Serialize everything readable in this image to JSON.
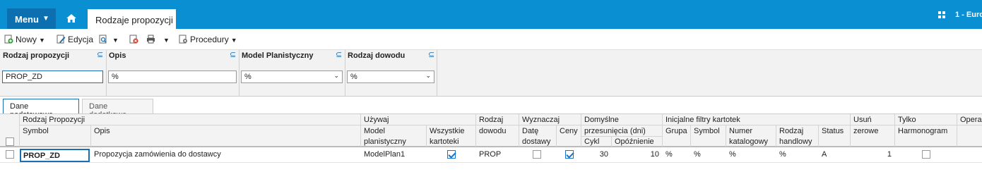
{
  "topbar": {
    "menu_label": "Menu",
    "tab_title": "Rodzaje propozycji",
    "company": "1 - Euro"
  },
  "toolbar": {
    "new_label": "Nowy",
    "edit_label": "Edycja",
    "procedures_label": "Procedury"
  },
  "filters": [
    {
      "label": "Rodzaj propozycji",
      "value": "PROP_ZD"
    },
    {
      "label": "Opis",
      "value": "%"
    },
    {
      "label": "Model Planistyczny",
      "value": "%"
    },
    {
      "label": "Rodzaj dowodu",
      "value": "%"
    }
  ],
  "subtabs": {
    "basic": "Dane podstawowe",
    "extra": "Dane dodatkowe"
  },
  "columns": {
    "group_rodzaj": "Rodzaj Propozycji",
    "symbol": "Symbol",
    "opis": "Opis",
    "uzywaj": "Używaj",
    "model_1": "Model",
    "model_2": "planistyczny",
    "wszystkie_1": "Wszystkie",
    "wszystkie_2": "kartoteki",
    "rodzaj_dowodu_1": "Rodzaj",
    "rodzaj_dowodu_2": "dowodu",
    "wyznaczaj": "Wyznaczaj",
    "date_1": "Datę",
    "date_2": "dostawy",
    "ceny": "Ceny",
    "domyslne_1": "Domyślne",
    "domyslne_2": "przesunięcia (dni)",
    "cykl": "Cykl",
    "opoznienie": "Opóźnienie",
    "inicjalne": "Inicjalne filtry kartotek",
    "grupa": "Grupa",
    "fsymbol": "Symbol",
    "numer_1": "Numer",
    "numer_2": "katalogowy",
    "handlowy_1": "Rodzaj",
    "handlowy_2": "handlowy",
    "status": "Status",
    "usun_1": "Usuń",
    "usun_2": "zerowe",
    "tylko_1": "Tylko",
    "tylko_2": "Harmonogram",
    "opera": "Opera"
  },
  "row": {
    "symbol": "PROP_ZD",
    "opis": "Propozycja zamówienia do dostawcy",
    "model": "ModelPlan1",
    "wszystkie": true,
    "rodzaj_dowodu": "PROP",
    "date_dostawy": false,
    "ceny": true,
    "cykl": "30",
    "opoznienie": "10",
    "grupa": "%",
    "fsymbol": "%",
    "numer": "%",
    "handlowy": "%",
    "status": "A",
    "usun": "1",
    "tylko": false
  }
}
